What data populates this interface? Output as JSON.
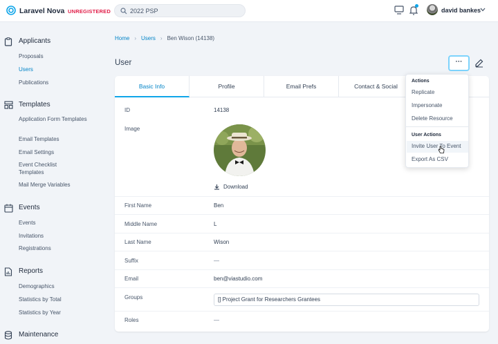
{
  "header": {
    "app_name": "Laravel Nova",
    "license_badge": "UNREGISTERED",
    "search_value": "2022 PSP",
    "user_name": "david bankes",
    "icons": [
      "nova-logo-icon",
      "search-icon",
      "screen-icon",
      "bell-icon",
      "avatar",
      "chevron-down-icon"
    ],
    "accent_color": "#0ea5e9",
    "badge_color": "#e11d48"
  },
  "sidebar": {
    "sections": [
      {
        "title": "Applicants",
        "icon": "clipboard-icon",
        "items": [
          "Proposals",
          "Users",
          "Publications"
        ]
      },
      {
        "title": "Templates",
        "icon": "grid-icon",
        "items": [
          "Application Form Templates",
          "Email Templates",
          "Email Settings",
          "Event Checklist Templates",
          "Mail Merge Variables"
        ]
      },
      {
        "title": "Events",
        "icon": "calendar-icon",
        "items": [
          "Events",
          "Invitations",
          "Registrations"
        ]
      },
      {
        "title": "Reports",
        "icon": "report-icon",
        "items": [
          "Demographics",
          "Statistics by Total",
          "Statistics by Year"
        ]
      },
      {
        "title": "Maintenance",
        "icon": "database-icon",
        "items": []
      }
    ],
    "active_item": "Users"
  },
  "breadcrumb": {
    "home": "Home",
    "users": "Users",
    "current": "Ben Wison (14138)"
  },
  "page": {
    "title": "User",
    "more_label": "···"
  },
  "tabs": [
    "Basic Info",
    "Profile",
    "Email Prefs",
    "Contact & Social"
  ],
  "fields": {
    "id": {
      "label": "ID",
      "value": "14138"
    },
    "image": {
      "label": "Image",
      "download": "Download"
    },
    "first_name": {
      "label": "First Name",
      "value": "Ben"
    },
    "middle_name": {
      "label": "Middle Name",
      "value": "L"
    },
    "last_name": {
      "label": "Last Name",
      "value": "Wison"
    },
    "suffix": {
      "label": "Suffix",
      "value": "—"
    },
    "email": {
      "label": "Email",
      "value": "ben@viastudio.com"
    },
    "groups": {
      "label": "Groups",
      "value": "[] Project Grant for Researchers Grantees"
    },
    "roles": {
      "label": "Roles",
      "value": "—"
    }
  },
  "actions_menu": {
    "actions_heading": "Actions",
    "actions": [
      "Replicate",
      "Impersonate",
      "Delete Resource"
    ],
    "user_actions_heading": "User Actions",
    "user_actions": [
      "Invite User To Event",
      "Export As CSV"
    ]
  }
}
